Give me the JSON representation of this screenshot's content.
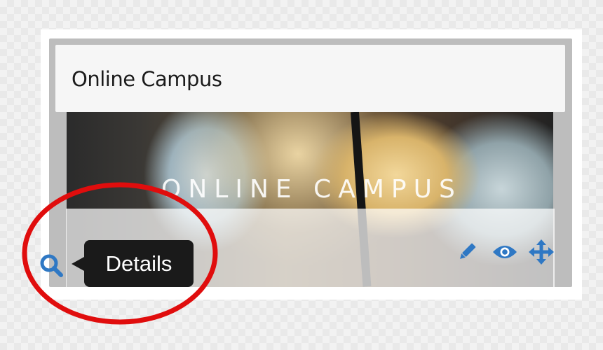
{
  "card": {
    "title": "Online Campus",
    "banner_text": "ONLINE CAMPUS"
  },
  "actions": {
    "search": {
      "icon": "search-icon",
      "tooltip": "Details"
    },
    "edit": {
      "icon": "pencil-icon"
    },
    "view": {
      "icon": "eye-icon"
    },
    "move": {
      "icon": "move-arrows-icon"
    }
  },
  "colors": {
    "accent_blue": "#2f78c4",
    "tooltip_bg": "#1a1a1a",
    "annotation_red": "#e00d0d"
  }
}
